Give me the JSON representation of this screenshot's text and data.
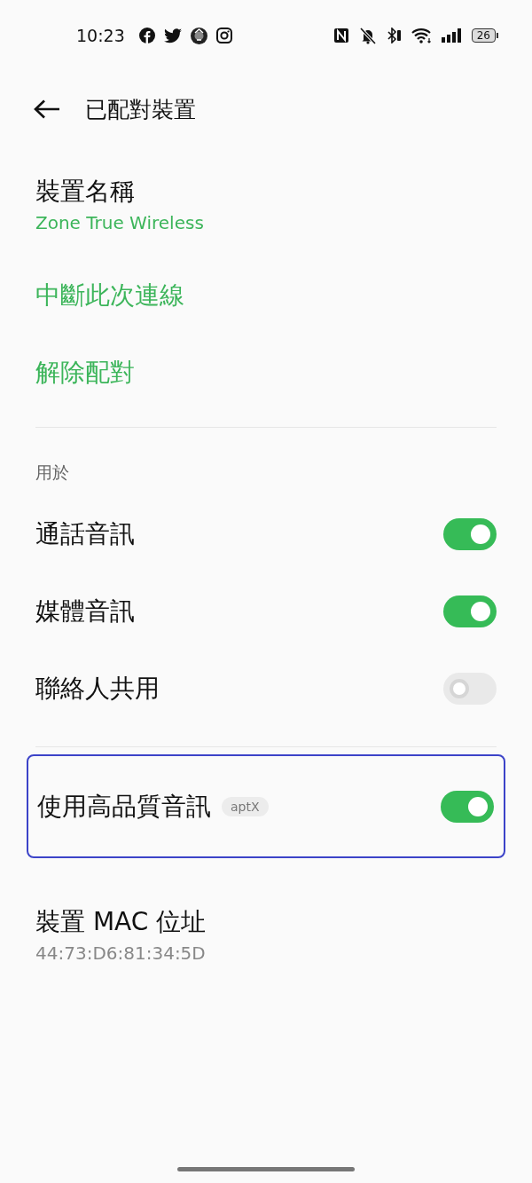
{
  "status_bar": {
    "time": "10:23",
    "battery": "26"
  },
  "header": {
    "title": "已配對裝置"
  },
  "device_name": {
    "label": "裝置名稱",
    "value": "Zone True Wireless"
  },
  "actions": [
    {
      "label": "中斷此次連線"
    },
    {
      "label": "解除配對"
    }
  ],
  "section": {
    "label": "用於"
  },
  "toggles": [
    {
      "label": "通話音訊",
      "on": true
    },
    {
      "label": "媒體音訊",
      "on": true
    },
    {
      "label": "聯絡人共用",
      "on": false
    }
  ],
  "hq_audio": {
    "label": "使用高品質音訊",
    "badge": "aptX",
    "on": true,
    "highlighted": true
  },
  "mac": {
    "label": "裝置 MAC 位址",
    "value": "44:73:D6:81:34:5D"
  }
}
